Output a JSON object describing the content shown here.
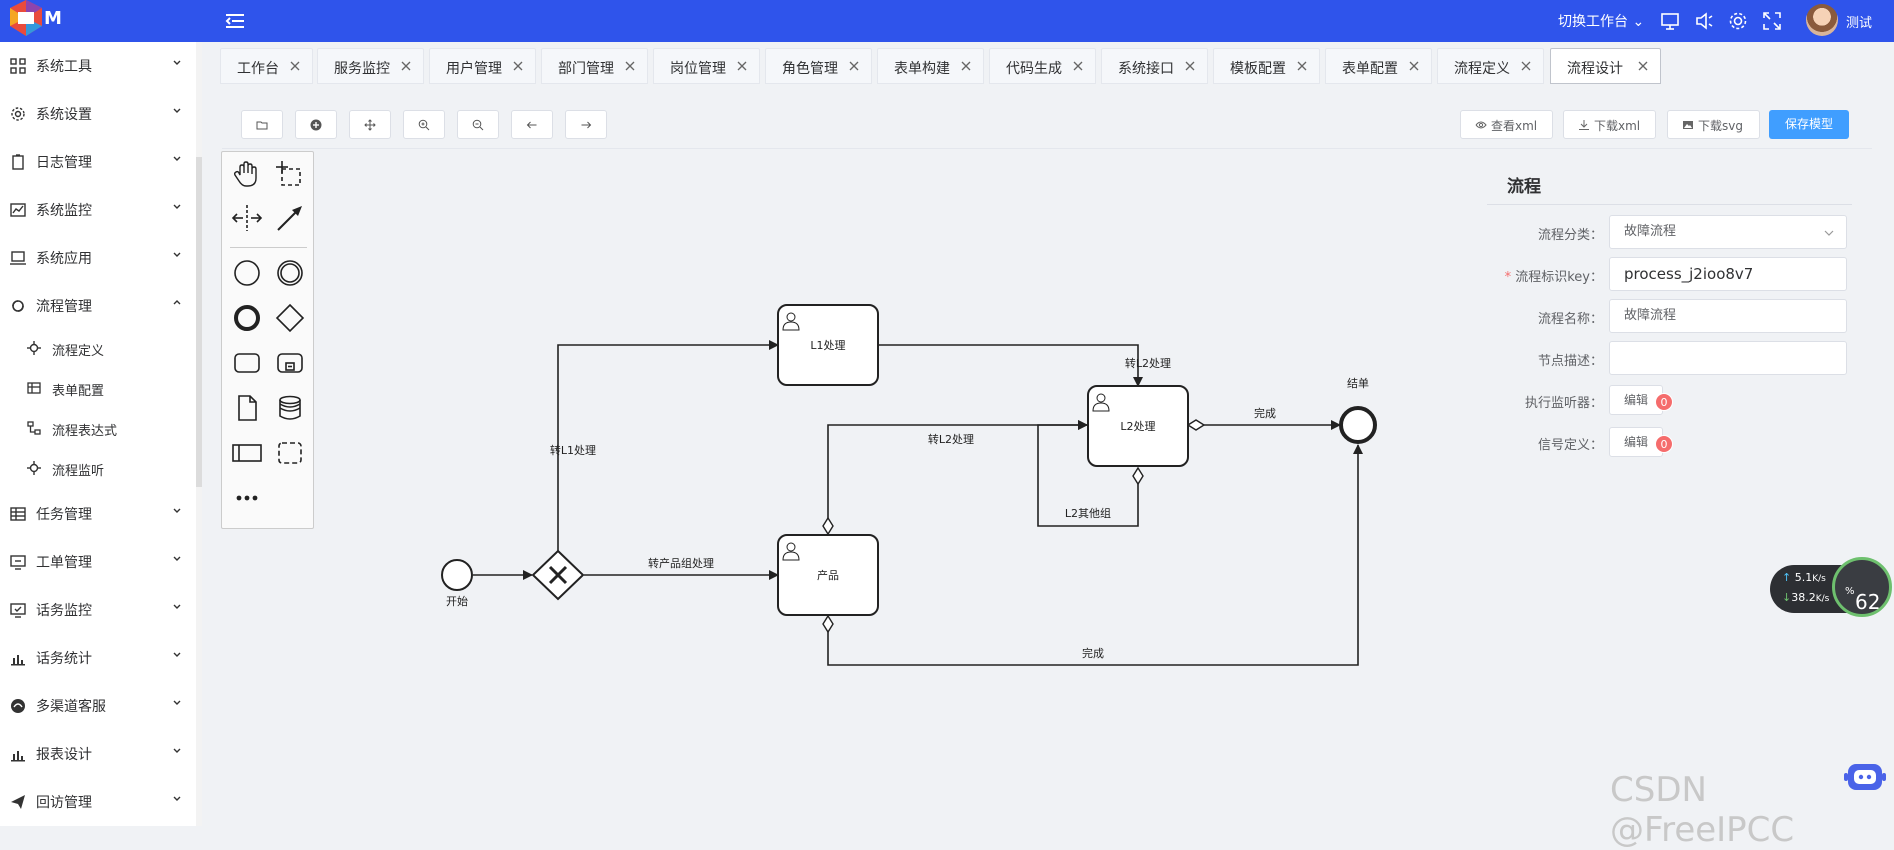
{
  "header": {
    "logo_text": "M",
    "workspace_switch": "切换工作台",
    "username": "测试"
  },
  "sidebar": {
    "items": [
      {
        "label": "系统工具",
        "icon": "grid-icon"
      },
      {
        "label": "系统设置",
        "icon": "gear-icon"
      },
      {
        "label": "日志管理",
        "icon": "clipboard-icon"
      },
      {
        "label": "系统监控",
        "icon": "chart-line-icon"
      },
      {
        "label": "系统应用",
        "icon": "laptop-icon"
      },
      {
        "label": "流程管理",
        "icon": "flow-icon",
        "expanded": true
      },
      {
        "label": "任务管理",
        "icon": "table-icon"
      },
      {
        "label": "工单管理",
        "icon": "monitor-icon"
      },
      {
        "label": "话务监控",
        "icon": "monitor-check-icon"
      },
      {
        "label": "话务统计",
        "icon": "bar-chart-icon"
      },
      {
        "label": "多渠道客服",
        "icon": "channel-icon"
      },
      {
        "label": "报表设计",
        "icon": "bar-chart-icon"
      },
      {
        "label": "回访管理",
        "icon": "paper-plane-icon"
      }
    ],
    "sub_items": [
      {
        "label": "流程定义",
        "icon": "bug-icon"
      },
      {
        "label": "表单配置",
        "icon": "table-icon"
      },
      {
        "label": "流程表达式",
        "icon": "tree-icon"
      },
      {
        "label": "流程监听",
        "icon": "bug-icon"
      }
    ]
  },
  "tabs": [
    {
      "label": "工作台"
    },
    {
      "label": "服务监控"
    },
    {
      "label": "用户管理"
    },
    {
      "label": "部门管理"
    },
    {
      "label": "岗位管理"
    },
    {
      "label": "角色管理"
    },
    {
      "label": "表单构建"
    },
    {
      "label": "代码生成"
    },
    {
      "label": "系统接口"
    },
    {
      "label": "模板配置"
    },
    {
      "label": "表单配置"
    },
    {
      "label": "流程定义"
    },
    {
      "label": "流程设计",
      "active": true
    }
  ],
  "toolbar": {
    "view_xml": "查看xml",
    "download_xml": "下载xml",
    "download_svg": "下载svg",
    "save_model": "保存模型"
  },
  "diagram": {
    "start": "开始",
    "end": "结单",
    "task_l1": "L1处理",
    "task_l2": "L2处理",
    "task_product": "产品",
    "flow_to_l1": "转L1处理",
    "flow_to_product": "转产品组处理",
    "flow_l1_to_l2": "转L2处理",
    "flow_product_to_l2": "转L2处理",
    "flow_l2_other": "L2其他组",
    "flow_l2_done": "完成",
    "flow_product_done": "完成"
  },
  "properties": {
    "title": "流程",
    "category_label": "流程分类：",
    "category_value": "故障流程",
    "key_label": "流程标识key：",
    "key_value": "process_j2ioo8v7",
    "name_label": "流程名称：",
    "name_value": "故障流程",
    "desc_label": "节点描述：",
    "desc_value": "",
    "listener_label": "执行监听器：",
    "signal_label": "信号定义：",
    "edit_label": "编辑",
    "listener_count": "0",
    "signal_count": "0"
  },
  "speed_widget": {
    "upload": "5.1",
    "download": "38.2",
    "unit": "K/s",
    "cpu_percent": "62",
    "percent_sign": "%"
  },
  "watermark": "CSDN @FreeIPCC"
}
